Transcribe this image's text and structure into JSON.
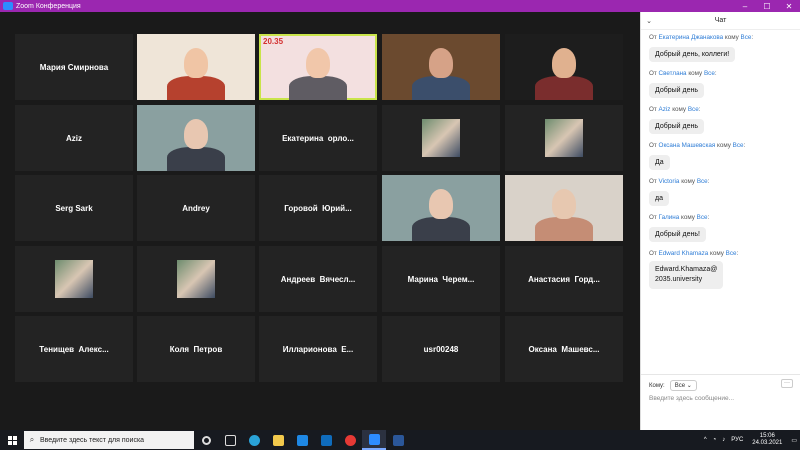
{
  "window": {
    "title": "Zoom Конференция",
    "controls": [
      "–",
      "☐",
      "✕"
    ]
  },
  "gallery": {
    "tiles": [
      {
        "type": "name",
        "label": "Мария Смирнова"
      },
      {
        "type": "video",
        "label": ""
      },
      {
        "type": "video",
        "label": "",
        "active": true,
        "overlay": "20.35"
      },
      {
        "type": "video",
        "label": ""
      },
      {
        "type": "video",
        "label": ""
      },
      {
        "type": "name",
        "label": "Aziz"
      },
      {
        "type": "video",
        "label": ""
      },
      {
        "type": "name",
        "label": "Екатерина  орло..."
      },
      {
        "type": "thumb",
        "label": ""
      },
      {
        "type": "thumb",
        "label": ""
      },
      {
        "type": "name",
        "label": "Serg Sark"
      },
      {
        "type": "name",
        "label": "Andrey"
      },
      {
        "type": "name",
        "label": "Горовой  Юрий..."
      },
      {
        "type": "video",
        "label": ""
      },
      {
        "type": "video",
        "label": ""
      },
      {
        "type": "thumb",
        "label": ""
      },
      {
        "type": "thumb",
        "label": ""
      },
      {
        "type": "name",
        "label": "Андреев  Вячесл..."
      },
      {
        "type": "name",
        "label": "Марина  Черем..."
      },
      {
        "type": "name",
        "label": "Анастасия  Горд..."
      },
      {
        "type": "name",
        "label": "Тенищев  Алекс..."
      },
      {
        "type": "name",
        "label": "Коля  Петров"
      },
      {
        "type": "name",
        "label": "Илларионова  Е..."
      },
      {
        "type": "name",
        "label": "usr00248"
      },
      {
        "type": "name",
        "label": "Оксана  Машевс..."
      }
    ]
  },
  "chat": {
    "title": "Чат",
    "messages": [
      {
        "from": "Екатерина Джанакова",
        "to": "Все",
        "text": "Добрый день, коллеги!"
      },
      {
        "from": "Светлана",
        "to": "Все",
        "text": "Добрый день"
      },
      {
        "from": "Aziz",
        "to": "Все",
        "text": "Добрый день"
      },
      {
        "from": "Оксана Машевская",
        "to": "Все",
        "text": "Да"
      },
      {
        "from": "Victoria",
        "to": "Все",
        "text": "да"
      },
      {
        "from": "Галина",
        "to": "Все",
        "text": "Добрый день!"
      },
      {
        "from": "Edward Khamaza",
        "to": "Все",
        "text": "Edward.Khamaza@\n2035.university"
      }
    ],
    "labels": {
      "from": "От",
      "to": "кому"
    },
    "to_label": "Кому:",
    "to_value": "Все",
    "input_placeholder": "Введите здесь сообщение...",
    "more_label": "···"
  },
  "taskbar": {
    "search_placeholder": "Введите здесь текст для поиска",
    "lang": "РУС",
    "time": "15:06",
    "date": "24.03.2021"
  },
  "colors": {
    "zoom_title": "#9b27b0",
    "accent": "#2d7cd6",
    "active_speaker": "#c9e44a"
  }
}
